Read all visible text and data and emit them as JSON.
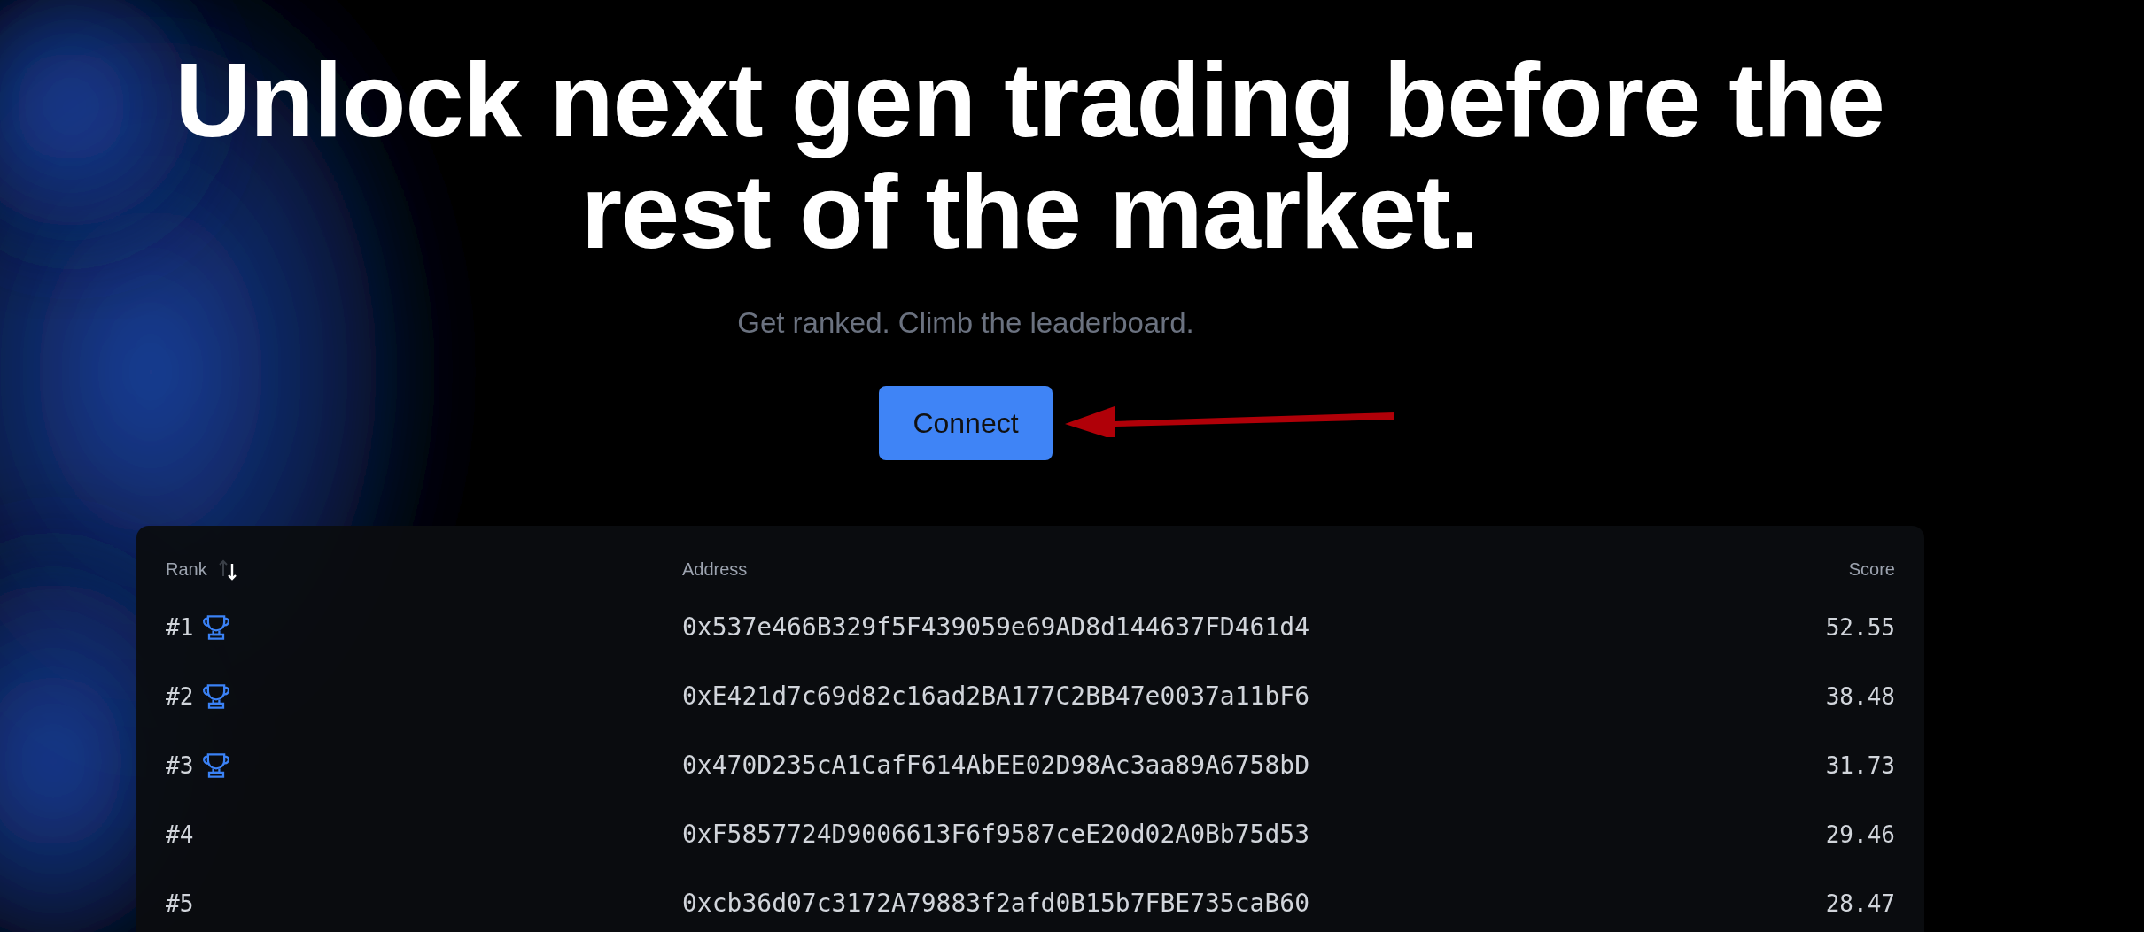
{
  "hero": {
    "heading_lines": [
      "Unlock next gen trading before the",
      "rest of the market."
    ],
    "subtitle": "Get ranked. Climb the leaderboard.",
    "button": "Connect"
  },
  "annotation": {
    "kind": "arrow"
  },
  "leaderboard": {
    "columns": [
      {
        "label": "Rank",
        "sort_descending": true
      },
      {
        "label": "Address"
      },
      {
        "label": "Score"
      }
    ],
    "rows": [
      {
        "rank": "#1",
        "trophy": true,
        "address": "0x537e466B329f5F439059e69AD8d144637FD461d4",
        "score": "52.55"
      },
      {
        "rank": "#2",
        "trophy": true,
        "address": "0xE421d7c69d82c16ad2BA177C2BB47e0037a11bF6",
        "score": "38.48"
      },
      {
        "rank": "#3",
        "trophy": true,
        "address": "0x470D235cA1CafF614AbEE02D98Ac3aa89A6758bD",
        "score": "31.73"
      },
      {
        "rank": "#4",
        "trophy": false,
        "address": "0xF5857724D9006613F6f9587ceE20d02A0Bb75d53",
        "score": "29.46"
      },
      {
        "rank": "#5",
        "trophy": false,
        "address": "0xcb36d07c3172A79883f2afd0B15b7FBE735caB60",
        "score": "28.47"
      }
    ]
  }
}
